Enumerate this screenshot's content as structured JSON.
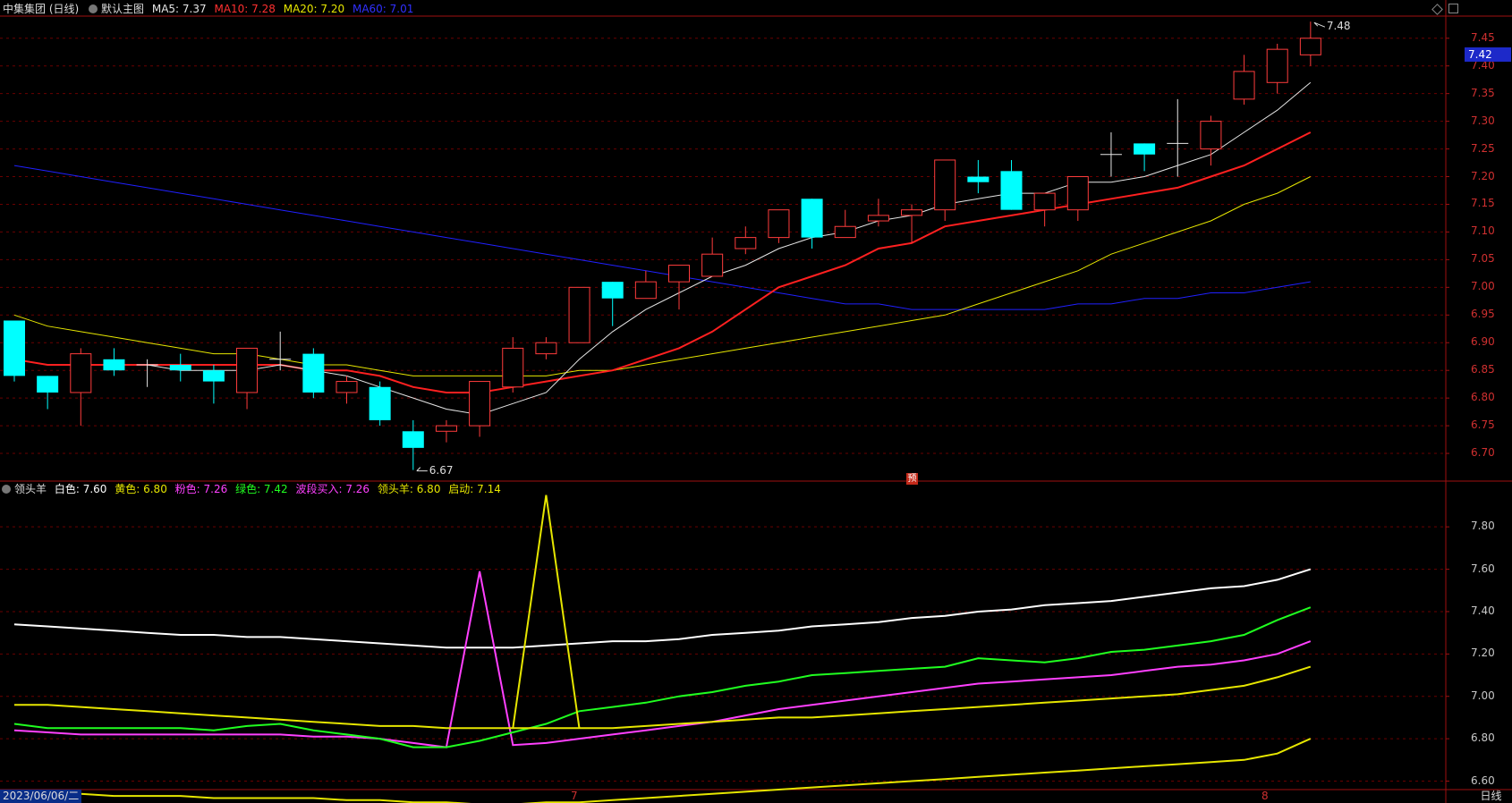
{
  "main_legend": {
    "title": "中集集团 (日线)",
    "template": "默认主图",
    "ma5": "MA5: 7.37",
    "ma10": "MA10: 7.28",
    "ma20": "MA20: 7.20",
    "ma60": "MA60: 7.01"
  },
  "sub_legend": {
    "name": "领头羊",
    "white": "白色: 7.60",
    "yellow": "黄色: 6.80",
    "pink": "粉色: 7.26",
    "green": "绿色: 7.42",
    "buy": "波段买入: 7.26",
    "leader": "领头羊: 6.80",
    "start": "启动: 7.14"
  },
  "colors": {
    "up": "#ff3c3c",
    "down": "#00ffff",
    "ma5": "#e6e6e6",
    "ma10": "#ff2020",
    "ma20": "#e6e600",
    "ma60": "#2020ff",
    "grid": "#6a0000",
    "frame": "#a01010"
  },
  "current_price": "7.42",
  "annotations": {
    "high": "7.48",
    "low": "6.67",
    "forecast_tag": "预"
  },
  "footer": {
    "date": "2023/06/06/二",
    "month_7": "7",
    "month_8": "8",
    "period": "日线"
  },
  "chart_data": [
    {
      "type": "candlestick",
      "title": "中集集团 (日线)",
      "ylim": [
        6.65,
        7.49
      ],
      "y_ticks": [
        "7.45",
        "7.40",
        "7.35",
        "7.30",
        "7.25",
        "7.20",
        "7.15",
        "7.10",
        "7.05",
        "7.00",
        "6.95",
        "6.90",
        "6.85",
        "6.80",
        "6.75",
        "6.70"
      ],
      "candles": [
        [
          6.94,
          6.84,
          6.94,
          6.83
        ],
        [
          6.84,
          6.81,
          6.84,
          6.78
        ],
        [
          6.81,
          6.88,
          6.89,
          6.75
        ],
        [
          6.87,
          6.85,
          6.89,
          6.84
        ],
        [
          6.86,
          6.86,
          6.87,
          6.82
        ],
        [
          6.86,
          6.85,
          6.88,
          6.83
        ],
        [
          6.85,
          6.83,
          6.86,
          6.79
        ],
        [
          6.81,
          6.89,
          6.89,
          6.78
        ],
        [
          6.87,
          6.87,
          6.92,
          6.85
        ],
        [
          6.88,
          6.81,
          6.89,
          6.8
        ],
        [
          6.81,
          6.83,
          6.84,
          6.79
        ],
        [
          6.82,
          6.76,
          6.83,
          6.75
        ],
        [
          6.74,
          6.71,
          6.76,
          6.67
        ],
        [
          6.74,
          6.75,
          6.76,
          6.72
        ],
        [
          6.75,
          6.83,
          6.83,
          6.73
        ],
        [
          6.82,
          6.89,
          6.91,
          6.81
        ],
        [
          6.88,
          6.9,
          6.91,
          6.87
        ],
        [
          6.9,
          7.0,
          7.0,
          6.9
        ],
        [
          7.01,
          6.98,
          7.01,
          6.93
        ],
        [
          6.98,
          7.01,
          7.03,
          6.98
        ],
        [
          7.01,
          7.04,
          7.04,
          6.96
        ],
        [
          7.02,
          7.06,
          7.09,
          7.02
        ],
        [
          7.07,
          7.09,
          7.11,
          7.06
        ],
        [
          7.09,
          7.14,
          7.14,
          7.08
        ],
        [
          7.16,
          7.09,
          7.16,
          7.07
        ],
        [
          7.09,
          7.11,
          7.14,
          7.09
        ],
        [
          7.12,
          7.13,
          7.16,
          7.11
        ],
        [
          7.13,
          7.14,
          7.15,
          7.08
        ],
        [
          7.14,
          7.23,
          7.23,
          7.12
        ],
        [
          7.2,
          7.19,
          7.23,
          7.17
        ],
        [
          7.21,
          7.14,
          7.23,
          7.14
        ],
        [
          7.14,
          7.17,
          7.17,
          7.11
        ],
        [
          7.14,
          7.2,
          7.2,
          7.12
        ],
        [
          7.24,
          7.24,
          7.28,
          7.2
        ],
        [
          7.26,
          7.24,
          7.26,
          7.21
        ],
        [
          7.26,
          7.26,
          7.34,
          7.2
        ],
        [
          7.25,
          7.3,
          7.31,
          7.22
        ],
        [
          7.34,
          7.39,
          7.42,
          7.33
        ],
        [
          7.37,
          7.43,
          7.44,
          7.35
        ],
        [
          7.42,
          7.45,
          7.48,
          7.4
        ]
      ],
      "series": [
        {
          "name": "MA5",
          "values": [
            null,
            null,
            null,
            null,
            6.86,
            6.85,
            6.85,
            6.85,
            6.86,
            6.85,
            6.84,
            6.82,
            6.8,
            6.78,
            6.77,
            6.79,
            6.81,
            6.87,
            6.92,
            6.96,
            6.99,
            7.02,
            7.04,
            7.07,
            7.09,
            7.1,
            7.12,
            7.13,
            7.15,
            7.16,
            7.17,
            7.17,
            7.19,
            7.19,
            7.2,
            7.22,
            7.24,
            7.28,
            7.32,
            7.37
          ]
        },
        {
          "name": "MA10",
          "values": [
            6.87,
            6.86,
            6.86,
            6.86,
            6.86,
            6.86,
            6.86,
            6.86,
            6.86,
            6.85,
            6.85,
            6.84,
            6.82,
            6.81,
            6.81,
            6.82,
            6.83,
            6.84,
            6.85,
            6.87,
            6.89,
            6.92,
            6.96,
            7.0,
            7.02,
            7.04,
            7.07,
            7.08,
            7.11,
            7.12,
            7.13,
            7.14,
            7.15,
            7.16,
            7.17,
            7.18,
            7.2,
            7.22,
            7.25,
            7.28
          ]
        },
        {
          "name": "MA20",
          "values": [
            6.95,
            6.93,
            6.92,
            6.91,
            6.9,
            6.89,
            6.88,
            6.88,
            6.87,
            6.86,
            6.86,
            6.85,
            6.84,
            6.84,
            6.84,
            6.84,
            6.84,
            6.85,
            6.85,
            6.86,
            6.87,
            6.88,
            6.89,
            6.9,
            6.91,
            6.92,
            6.93,
            6.94,
            6.95,
            6.97,
            6.99,
            7.01,
            7.03,
            7.06,
            7.08,
            7.1,
            7.12,
            7.15,
            7.17,
            7.2
          ]
        },
        {
          "name": "MA60",
          "values": [
            7.22,
            7.21,
            7.2,
            7.19,
            7.18,
            7.17,
            7.16,
            7.15,
            7.14,
            7.13,
            7.12,
            7.11,
            7.1,
            7.09,
            7.08,
            7.07,
            7.06,
            7.05,
            7.04,
            7.03,
            7.02,
            7.01,
            7.0,
            6.99,
            6.98,
            6.97,
            6.97,
            6.96,
            6.96,
            6.96,
            6.96,
            6.96,
            6.97,
            6.97,
            6.98,
            6.98,
            6.99,
            6.99,
            7.0,
            7.01
          ]
        }
      ]
    },
    {
      "type": "line",
      "title": "领头羊",
      "ylim": [
        6.56,
        7.94
      ],
      "y_ticks": [
        "7.80",
        "7.60",
        "7.40",
        "7.20",
        "7.00",
        "6.80",
        "6.60"
      ],
      "series": [
        {
          "name": "白色",
          "values": [
            7.34,
            7.33,
            7.32,
            7.31,
            7.3,
            7.29,
            7.29,
            7.28,
            7.28,
            7.27,
            7.26,
            7.25,
            7.24,
            7.23,
            7.23,
            7.23,
            7.24,
            7.25,
            7.26,
            7.26,
            7.27,
            7.29,
            7.3,
            7.31,
            7.33,
            7.34,
            7.35,
            7.37,
            7.38,
            7.4,
            7.41,
            7.43,
            7.44,
            7.45,
            7.47,
            7.49,
            7.51,
            7.52,
            7.55,
            7.6
          ]
        },
        {
          "name": "黄色",
          "values": [
            6.55,
            6.54,
            6.54,
            6.53,
            6.53,
            6.53,
            6.52,
            6.52,
            6.52,
            6.52,
            6.51,
            6.51,
            6.5,
            6.5,
            6.49,
            6.49,
            6.5,
            6.5,
            6.51,
            6.52,
            6.53,
            6.54,
            6.55,
            6.56,
            6.57,
            6.58,
            6.59,
            6.6,
            6.61,
            6.62,
            6.63,
            6.64,
            6.65,
            6.66,
            6.67,
            6.68,
            6.69,
            6.7,
            6.73,
            6.8
          ]
        },
        {
          "name": "粉色",
          "values": [
            6.84,
            6.83,
            6.82,
            6.82,
            6.82,
            6.82,
            6.82,
            6.82,
            6.82,
            6.81,
            6.81,
            6.8,
            6.78,
            6.76,
            7.59,
            6.77,
            6.78,
            6.8,
            6.82,
            6.84,
            6.86,
            6.88,
            6.91,
            6.94,
            6.96,
            6.98,
            7.0,
            7.02,
            7.04,
            7.06,
            7.07,
            7.08,
            7.09,
            7.1,
            7.12,
            7.14,
            7.15,
            7.17,
            7.2,
            7.26
          ]
        },
        {
          "name": "绿色",
          "values": [
            6.87,
            6.85,
            6.85,
            6.85,
            6.85,
            6.85,
            6.84,
            6.86,
            6.87,
            6.84,
            6.82,
            6.8,
            6.76,
            6.76,
            6.79,
            6.83,
            6.87,
            6.93,
            6.95,
            6.97,
            7.0,
            7.02,
            7.05,
            7.07,
            7.1,
            7.11,
            7.12,
            7.13,
            7.14,
            7.18,
            7.17,
            7.16,
            7.18,
            7.21,
            7.22,
            7.24,
            7.26,
            7.29,
            7.36,
            7.42
          ]
        },
        {
          "name": "启动",
          "values": [
            6.96,
            6.96,
            6.95,
            6.94,
            6.93,
            6.92,
            6.91,
            6.9,
            6.89,
            6.88,
            6.87,
            6.86,
            6.86,
            6.85,
            6.85,
            6.85,
            6.85,
            6.85,
            6.85,
            6.86,
            6.87,
            6.88,
            6.89,
            6.9,
            6.9,
            6.91,
            6.92,
            6.93,
            6.94,
            6.95,
            6.96,
            6.97,
            6.98,
            6.99,
            7.0,
            7.01,
            7.03,
            7.05,
            7.09,
            7.14
          ]
        },
        {
          "name": "领头羊",
          "values": [
            null,
            null,
            null,
            null,
            null,
            null,
            null,
            null,
            null,
            null,
            null,
            null,
            null,
            null,
            null,
            null,
            7.95,
            null,
            null,
            null,
            null,
            null,
            null,
            null,
            null,
            null,
            null,
            null,
            null,
            null,
            null,
            null,
            null,
            null,
            null,
            null,
            null,
            null,
            null,
            null
          ]
        }
      ]
    }
  ]
}
